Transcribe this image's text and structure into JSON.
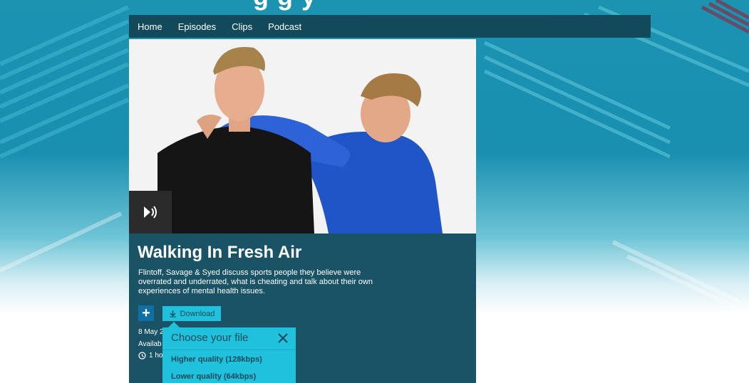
{
  "brand": {
    "title_partial": "g   g   y"
  },
  "nav": {
    "items": [
      {
        "label": "Home"
      },
      {
        "label": "Episodes"
      },
      {
        "label": "Clips"
      },
      {
        "label": "Podcast"
      }
    ]
  },
  "episode": {
    "title": "Walking In Fresh Air",
    "description": "Flintoff, Savage & Syed discuss sports people they believe were overrated and underrated, what is cheating and talk about their own experiences of mental health issues.",
    "date_partial": "8 May 2",
    "availability_partial": "Availab",
    "duration_partial": "1 ho",
    "audio_icon": "audio-play-icon",
    "add_icon": "plus-icon"
  },
  "download": {
    "label": "Download",
    "icon": "download-arrow-icon"
  },
  "file_chooser": {
    "heading": "Choose your file",
    "close_icon": "close-icon",
    "options": [
      {
        "label": "Higher quality (128kbps)"
      },
      {
        "label": "Lower quality (64kbps)"
      }
    ]
  },
  "colors": {
    "nav_bg": "#124a5b",
    "card_bg": "#195365",
    "accent": "#1fc1dc",
    "add_button": "#0d6fa3"
  }
}
